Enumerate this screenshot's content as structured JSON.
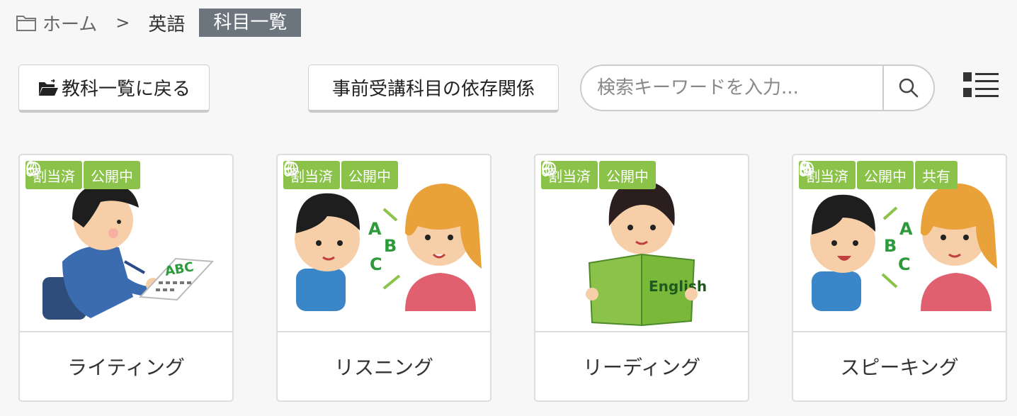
{
  "breadcrumb": {
    "home": "ホーム",
    "separator": ">",
    "subject": "英語",
    "current": "科目一覧"
  },
  "toolbar": {
    "back_label": "教科一覧に戻る",
    "deps_label": "事前受講科目の依存関係",
    "search_placeholder": "検索キーワードを入力..."
  },
  "badge_labels": {
    "assigned": "割当済",
    "public": "公開中",
    "shared": "共有"
  },
  "courses": [
    {
      "title": "ライティング",
      "image": "writing-illustration",
      "badges": [
        "割当済",
        "公開中"
      ]
    },
    {
      "title": "リスニング",
      "image": "listening-illustration",
      "badges": [
        "割当済",
        "公開中"
      ]
    },
    {
      "title": "リーディング",
      "image": "reading-illustration",
      "badges": [
        "割当済",
        "公開中"
      ]
    },
    {
      "title": "スピーキング",
      "image": "speaking-illustration",
      "badges": [
        "割当済",
        "公開中",
        "共有"
      ]
    }
  ],
  "illustration_text": {
    "abc_letters": "ABC",
    "a": "A",
    "b": "B",
    "c": "C",
    "book_label": "English"
  },
  "colors": {
    "badge_green": "#8bc34a",
    "breadcrumb_current_bg": "#6c757d"
  }
}
